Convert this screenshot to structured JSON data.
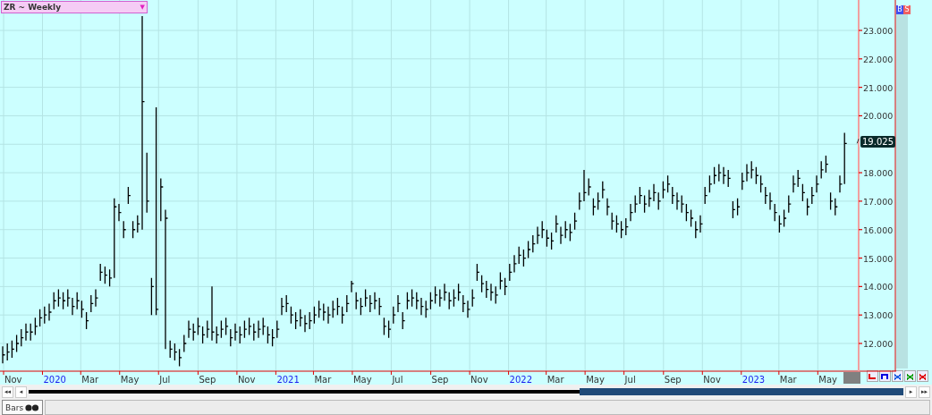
{
  "chart_panel": {
    "title_dropdown": {
      "label": "ZR ~ Weekly",
      "caret": "▼"
    },
    "last_price": "19.025",
    "price_axis": {
      "upper": [
        "23.000",
        "22.000",
        "21.000",
        "20.000"
      ],
      "lower": [
        "18.000",
        "17.000",
        "16.000",
        "15.000",
        "14.000",
        "13.000",
        "12.000"
      ]
    },
    "time_axis": [
      {
        "label": "Nov",
        "kind": "month"
      },
      {
        "label": "2020",
        "kind": "year"
      },
      {
        "label": "Mar",
        "kind": "month"
      },
      {
        "label": "May",
        "kind": "month"
      },
      {
        "label": "Jul",
        "kind": "month"
      },
      {
        "label": "Sep",
        "kind": "month"
      },
      {
        "label": "Nov",
        "kind": "month"
      },
      {
        "label": "2021",
        "kind": "year"
      },
      {
        "label": "Mar",
        "kind": "month"
      },
      {
        "label": "May",
        "kind": "month"
      },
      {
        "label": "Jul",
        "kind": "month"
      },
      {
        "label": "Sep",
        "kind": "month"
      },
      {
        "label": "Nov",
        "kind": "month"
      },
      {
        "label": "2022",
        "kind": "year"
      },
      {
        "label": "Mar",
        "kind": "month"
      },
      {
        "label": "May",
        "kind": "month"
      },
      {
        "label": "Jul",
        "kind": "month"
      },
      {
        "label": "Sep",
        "kind": "month"
      },
      {
        "label": "Nov",
        "kind": "month"
      },
      {
        "label": "2023",
        "kind": "year"
      },
      {
        "label": "Mar",
        "kind": "month"
      },
      {
        "label": "May",
        "kind": "month"
      }
    ]
  },
  "side_buttons": [
    {
      "label": "B",
      "kind": "buy"
    },
    {
      "label": "S",
      "kind": "sell"
    }
  ],
  "tool_buttons": [
    {
      "kind": "step-down",
      "color": "#e00000"
    },
    {
      "kind": "step-up",
      "color": "#0000e0"
    },
    {
      "kind": "cross",
      "color": "#2060e0"
    },
    {
      "kind": "cross",
      "color": "#00a000"
    },
    {
      "kind": "cross",
      "color": "#e00000"
    }
  ],
  "scroll_buttons": [
    {
      "glyph": "◂◂",
      "kind": "first"
    },
    {
      "glyph": "◂",
      "kind": "prev"
    },
    {
      "glyph": "▸",
      "kind": "next"
    },
    {
      "glyph": "▸▸",
      "kind": "last"
    }
  ],
  "bottom_tabs": [
    {
      "label": "Bars",
      "selected": true
    }
  ]
}
